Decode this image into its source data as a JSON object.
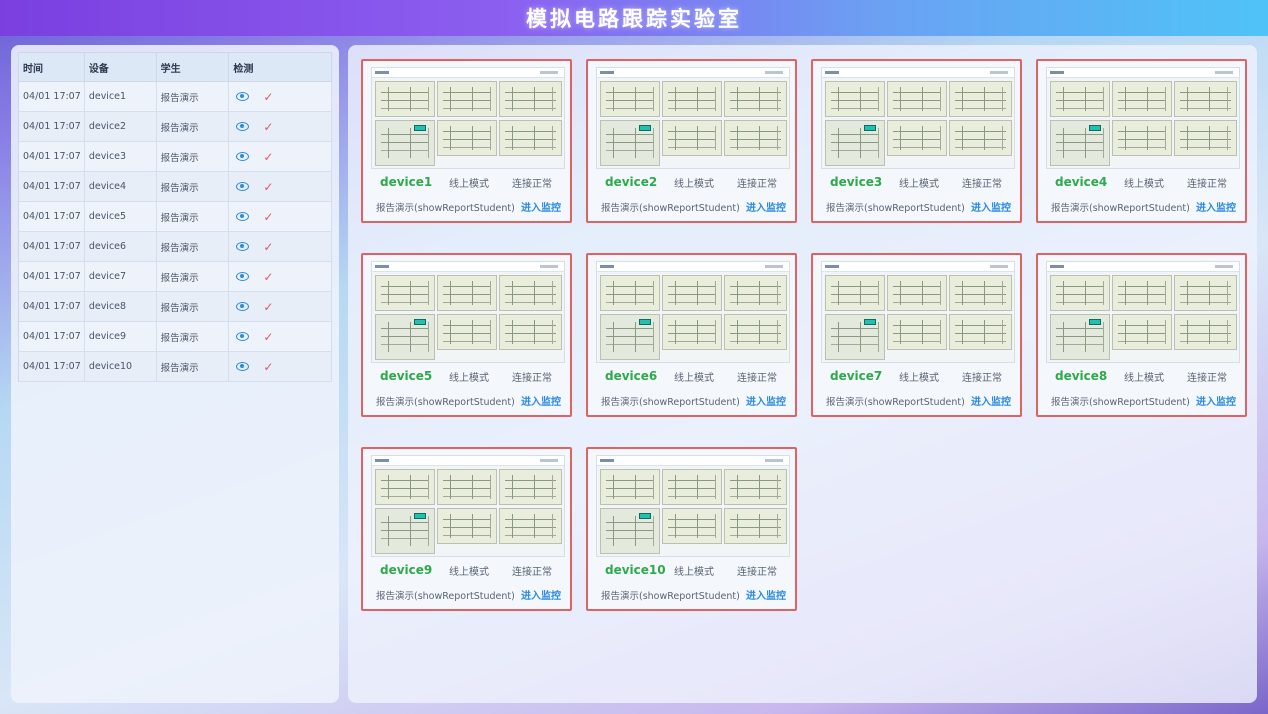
{
  "header": {
    "title": "模拟电路跟踪实验室"
  },
  "log_table": {
    "columns": [
      "时间",
      "设备",
      "学生",
      "检测"
    ],
    "rows": [
      {
        "time": "04/01 17:07",
        "device": "device1",
        "student": "报告演示"
      },
      {
        "time": "04/01 17:07",
        "device": "device2",
        "student": "报告演示"
      },
      {
        "time": "04/01 17:07",
        "device": "device3",
        "student": "报告演示"
      },
      {
        "time": "04/01 17:07",
        "device": "device4",
        "student": "报告演示"
      },
      {
        "time": "04/01 17:07",
        "device": "device5",
        "student": "报告演示"
      },
      {
        "time": "04/01 17:07",
        "device": "device6",
        "student": "报告演示"
      },
      {
        "time": "04/01 17:07",
        "device": "device7",
        "student": "报告演示"
      },
      {
        "time": "04/01 17:07",
        "device": "device8",
        "student": "报告演示"
      },
      {
        "time": "04/01 17:07",
        "device": "device9",
        "student": "报告演示"
      },
      {
        "time": "04/01 17:07",
        "device": "device10",
        "student": "报告演示"
      }
    ]
  },
  "devices": [
    {
      "name": "device1",
      "mode": "线上模式",
      "status": "连接正常",
      "student": "报告演示(showReportStudent)",
      "action": "进入监控"
    },
    {
      "name": "device2",
      "mode": "线上模式",
      "status": "连接正常",
      "student": "报告演示(showReportStudent)",
      "action": "进入监控"
    },
    {
      "name": "device3",
      "mode": "线上模式",
      "status": "连接正常",
      "student": "报告演示(showReportStudent)",
      "action": "进入监控"
    },
    {
      "name": "device4",
      "mode": "线上模式",
      "status": "连接正常",
      "student": "报告演示(showReportStudent)",
      "action": "进入监控"
    },
    {
      "name": "device5",
      "mode": "线上模式",
      "status": "连接正常",
      "student": "报告演示(showReportStudent)",
      "action": "进入监控"
    },
    {
      "name": "device6",
      "mode": "线上模式",
      "status": "连接正常",
      "student": "报告演示(showReportStudent)",
      "action": "进入监控"
    },
    {
      "name": "device7",
      "mode": "线上模式",
      "status": "连接正常",
      "student": "报告演示(showReportStudent)",
      "action": "进入监控"
    },
    {
      "name": "device8",
      "mode": "线上模式",
      "status": "连接正常",
      "student": "报告演示(showReportStudent)",
      "action": "进入监控"
    },
    {
      "name": "device9",
      "mode": "线上模式",
      "status": "连接正常",
      "student": "报告演示(showReportStudent)",
      "action": "进入监控"
    },
    {
      "name": "device10",
      "mode": "线上模式",
      "status": "连接正常",
      "student": "报告演示(showReportStudent)",
      "action": "进入监控"
    }
  ],
  "colors": {
    "accent": "#2a8be0",
    "device_name": "#2eaa4a",
    "card_border": "#dd6464",
    "check": "#e05a5a"
  },
  "icons": {
    "detect": "eye-icon",
    "ok": "check-icon"
  }
}
